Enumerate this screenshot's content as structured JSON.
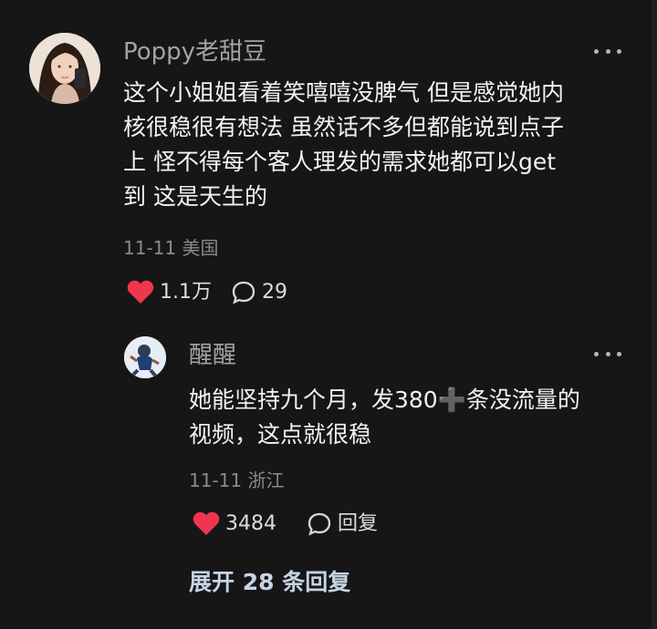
{
  "comment": {
    "username": "Poppy老甜豆",
    "text_lines": [
      "这个小姐姐看着笑嘻嘻没脾气 但是感觉她内",
      "核很稳很有想法 虽然话不多但都能说到点子",
      "上 怪不得每个客人理发的需求她都可以get",
      "到 这是天生的"
    ],
    "meta": "11-11 美国",
    "like_count": "1.1万",
    "reply_count": "29",
    "like_color": "#f0354f"
  },
  "reply": {
    "username": "醒醒",
    "text_lines": [
      {
        "before": "她能坚持九个月，发380",
        "symbol": "➕",
        "after": "条没流量的"
      },
      {
        "before": "视频，这点就很稳",
        "symbol": "",
        "after": ""
      }
    ],
    "meta": "11-11 浙江",
    "like_count": "3484",
    "reply_label": "回复",
    "like_color": "#f0354f"
  },
  "expand_label": "展开 28 条回复",
  "icons": {
    "more": "more-dots-icon",
    "heart": "heart-icon",
    "comment": "comment-bubble-icon"
  }
}
